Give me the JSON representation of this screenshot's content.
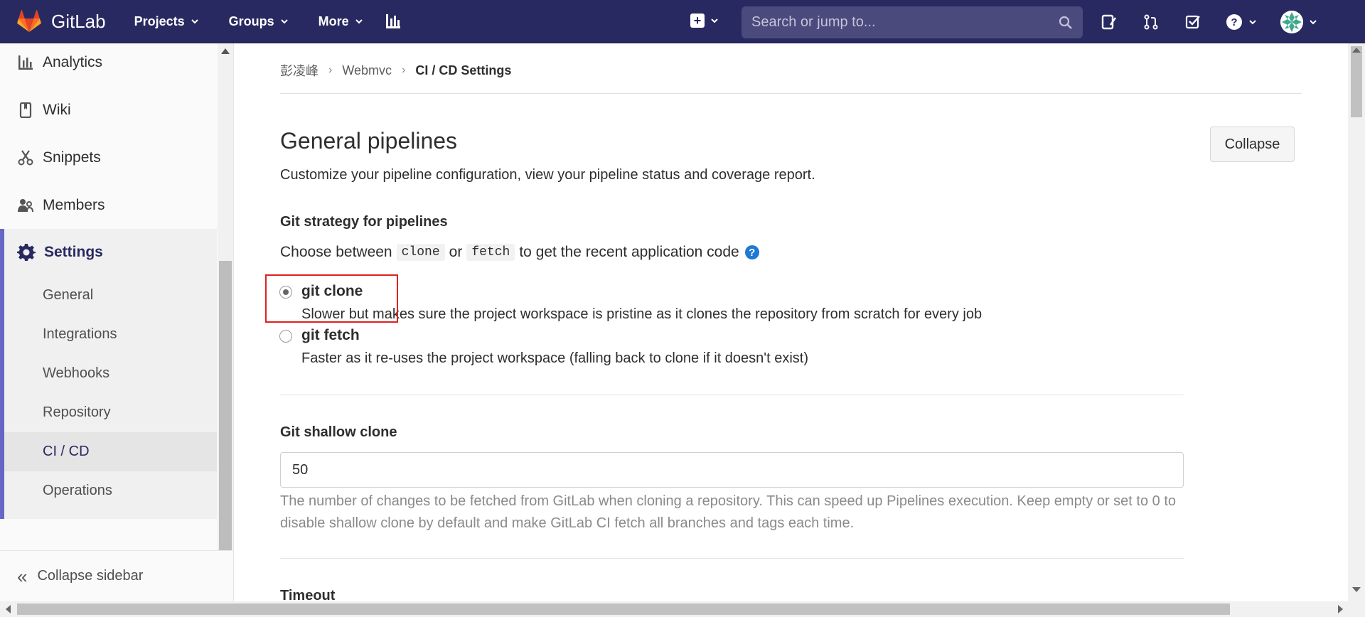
{
  "navbar": {
    "brand": "GitLab",
    "items": [
      {
        "label": "Projects"
      },
      {
        "label": "Groups"
      },
      {
        "label": "More"
      }
    ],
    "search_placeholder": "Search or jump to...",
    "background": "#292961"
  },
  "sidebar": {
    "items": [
      {
        "label": "Analytics",
        "icon": "analytics-icon"
      },
      {
        "label": "Wiki",
        "icon": "book-icon"
      },
      {
        "label": "Snippets",
        "icon": "scissors-icon"
      },
      {
        "label": "Members",
        "icon": "members-icon"
      }
    ],
    "active_section": {
      "label": "Settings",
      "icon": "gear-icon"
    },
    "sub_items": [
      {
        "label": "General"
      },
      {
        "label": "Integrations"
      },
      {
        "label": "Webhooks"
      },
      {
        "label": "Repository"
      },
      {
        "label": "CI / CD",
        "active": true
      },
      {
        "label": "Operations"
      }
    ],
    "collapse_label": "Collapse sidebar",
    "accent": "#6666c4"
  },
  "breadcrumb": {
    "items": [
      "彭凌峰",
      "Webmvc"
    ],
    "current": "CI / CD Settings"
  },
  "section": {
    "title": "General pipelines",
    "subtitle": "Customize your pipeline configuration, view your pipeline status and coverage report.",
    "collapse_label": "Collapse"
  },
  "git_strategy": {
    "label": "Git strategy for pipelines",
    "choose_prefix": "Choose between",
    "code_clone": "clone",
    "or_text": "or",
    "code_fetch": "fetch",
    "choose_suffix": "to get the recent application code",
    "options": [
      {
        "title": "git clone",
        "description": "Slower but makes sure the project workspace is pristine as it clones the repository from scratch for every job",
        "selected": true
      },
      {
        "title": "git fetch",
        "description": "Faster as it re-uses the project workspace (falling back to clone if it doesn't exist)",
        "selected": false
      }
    ]
  },
  "shallow_clone": {
    "label": "Git shallow clone",
    "value": "50",
    "help": "The number of changes to be fetched from GitLab when cloning a repository. This can speed up Pipelines execution. Keep empty or set to 0 to disable shallow clone by default and make GitLab CI fetch all branches and tags each time."
  },
  "timeout": {
    "label": "Timeout"
  }
}
